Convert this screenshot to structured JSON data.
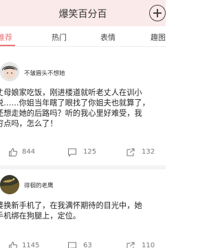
{
  "header": {
    "title": "爆笑百分百"
  },
  "tabs": [
    {
      "label": "推荐"
    },
    {
      "label": "热门"
    },
    {
      "label": "表情"
    },
    {
      "label": "趣图"
    }
  ],
  "posts": [
    {
      "author": "不皱眉头不想她",
      "lines": [
        "丈母娘家吃饭，刚进楼道就听老丈人在训小",
        "说……你姐当年瞎了眼找了你姐夫也就算了，",
        "还想走她的后路吗？听的我心里好难受，我",
        "穷点吗，怎么了！"
      ],
      "likes": "844",
      "comments": "125",
      "shares": "132"
    },
    {
      "author": "徘徊的老鹰",
      "lines": [
        "婆换新手机了，在我满怀期待的目光中，她",
        "手机绑在狗腿上，定位。"
      ],
      "likes": "1145",
      "comments": "63",
      "shares": "110"
    }
  ],
  "colors": {
    "accent": "#e8737a",
    "header_bg": "#fbeaea"
  }
}
